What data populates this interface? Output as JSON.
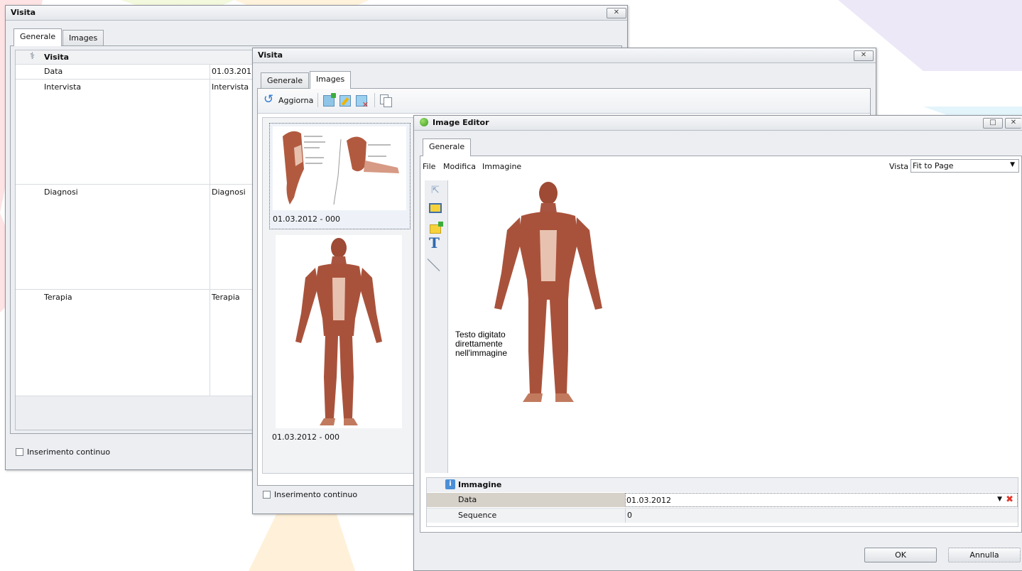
{
  "window1": {
    "title": "Visita",
    "close_label": "✕",
    "tabs": [
      {
        "label": "Generale"
      },
      {
        "label": "Images"
      }
    ],
    "group_title": "Visita",
    "rows": [
      {
        "label": "Data",
        "value": "01.03.201"
      },
      {
        "label": "Intervista",
        "value": "Intervista"
      },
      {
        "label": "Diagnosi",
        "value": "Diagnosi"
      },
      {
        "label": "Terapia",
        "value": "Terapia"
      }
    ],
    "continuous_label": "Inserimento continuo"
  },
  "window2": {
    "title": "Visita",
    "close_label": "✕",
    "tabs": [
      {
        "label": "Generale"
      },
      {
        "label": "Images"
      }
    ],
    "refresh_label": "Aggiorna",
    "thumbnails": [
      {
        "caption": "01.03.2012 - 000"
      },
      {
        "caption": "01.03.2012 - 000"
      }
    ],
    "continuous_label": "Inserimento continuo"
  },
  "editor": {
    "title": "Image Editor",
    "max_label": "□",
    "close_label": "✕",
    "tab": "Generale",
    "menu": {
      "file": "File",
      "modifica": "Modifica",
      "immagine": "Immagine",
      "vista_label": "Vista"
    },
    "vista_value": "Fit to Page",
    "overlay_text": [
      "Testo digitato",
      "direttamente",
      "nell'immagine"
    ],
    "props": {
      "group": "Immagine",
      "rows": [
        {
          "label": "Data",
          "value": "01.03.2012"
        },
        {
          "label": "Sequence",
          "value": "0"
        }
      ]
    },
    "ok_label": "OK",
    "cancel_label": "Annulla"
  }
}
